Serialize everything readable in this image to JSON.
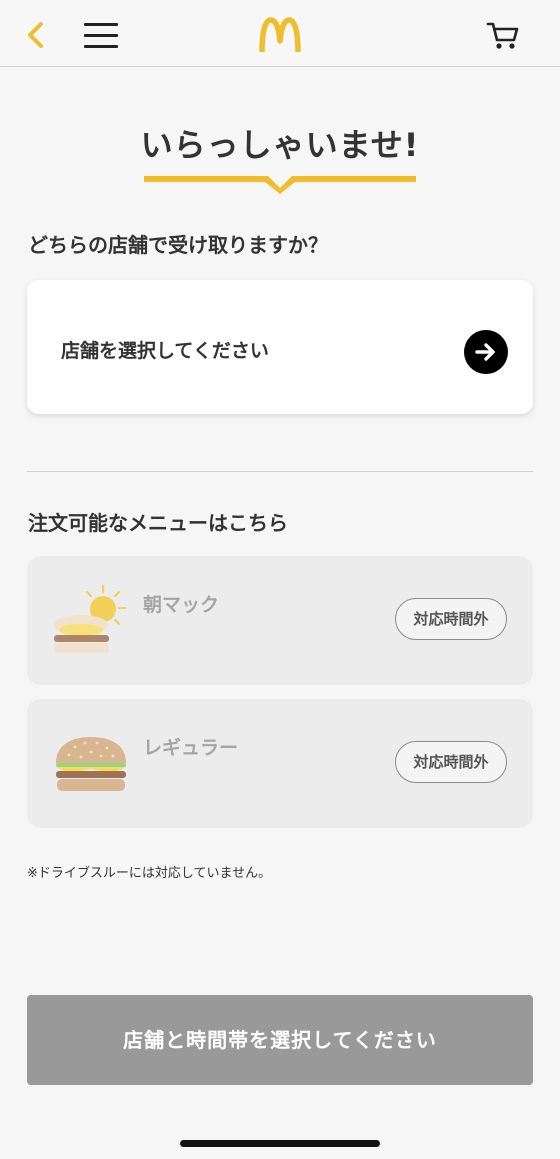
{
  "header": {
    "back_icon": "chevron-left-icon",
    "menu_icon": "hamburger-menu-icon",
    "logo_icon": "golden-arches-logo",
    "cart_icon": "cart-icon",
    "accent_color": "#f0bd2c"
  },
  "welcome": {
    "title": "いらっしゃいませ!"
  },
  "store": {
    "question": "どちらの店舗で受け取りますか？",
    "select_label": "店舗を選択してください",
    "arrow_icon": "arrow-right-circle-icon"
  },
  "menu_section": {
    "title": "注文可能なメニューはこちら",
    "items": [
      {
        "name": "朝マック",
        "status": "対応時間外",
        "icon": "breakfast-sun-icon"
      },
      {
        "name": "レギュラー",
        "status": "対応時間外",
        "icon": "burger-icon"
      }
    ]
  },
  "note": "※ドライブスルーには対応していません。",
  "submit": {
    "label": "店舗と時間帯を選択してください",
    "color": "#999999"
  }
}
